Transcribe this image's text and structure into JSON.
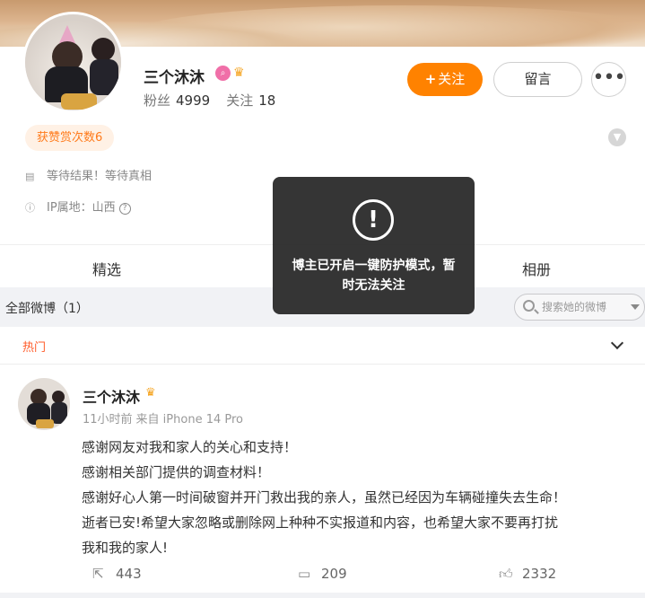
{
  "profile": {
    "name": "三个沐沐",
    "fans_label": "粉丝",
    "fans_count": "4999",
    "following_label": "关注",
    "following_count": "18",
    "follow_button": "关注",
    "message_button": "留言",
    "reward_text": "获赞赏次数6",
    "bio": "等待结果！等待真相",
    "ip_location": "IP属地：山西"
  },
  "tabs": [
    "精选",
    "相册"
  ],
  "feed": {
    "filter_label": "全部微博（1）",
    "search_placeholder": "搜索她的微博",
    "hot_label": "热门"
  },
  "post": {
    "author": "三个沐沐",
    "time": "11小时前",
    "source": "来自 iPhone 14 Pro",
    "lines": [
      "感谢网友对我和家人的关心和支持！",
      "感谢相关部门提供的调查材料！",
      "感谢好心人第一时间破窗并开门救出我的亲人，虽然已经因为车辆碰撞失去生命！",
      "逝者已安!希望大家忽略或删除网上种种不实报道和内容，也希望大家不要再打扰",
      "我和我的家人!"
    ],
    "reposts": "443",
    "comments": "209",
    "likes": "2332"
  },
  "toast": {
    "message": "博主已开启一键防护模式，暂时无法关注"
  },
  "colors": {
    "accent": "#ff8200",
    "hot": "#ff5b29",
    "reward_text": "#ff7a1a"
  },
  "icons": {
    "badge_vip": "search-badge-icon",
    "badge_crown": "crown-icon",
    "bio": "document-icon",
    "ip": "ip-icon",
    "expand": "chevron-down-icon",
    "repost": "share-icon",
    "comment": "comment-icon",
    "like": "thumbs-up-icon",
    "warning": "warning-icon"
  }
}
